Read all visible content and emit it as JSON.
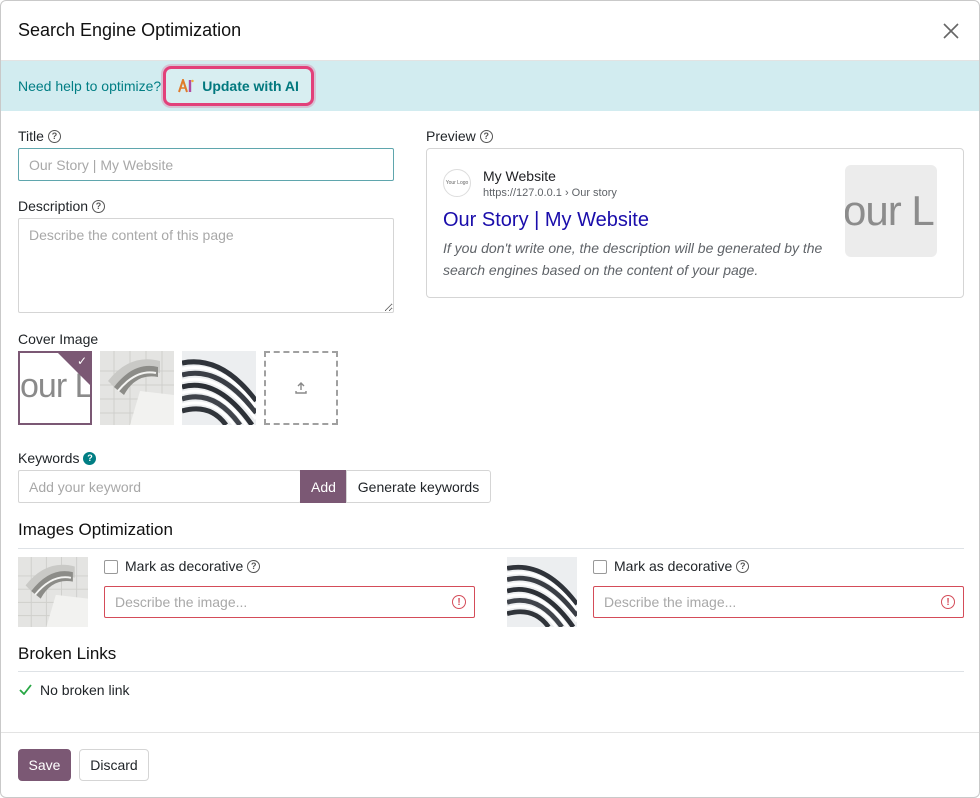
{
  "dialog": {
    "title": "Search Engine Optimization"
  },
  "banner": {
    "text": "Need help to optimize?",
    "ai_button_label": "Update with AI"
  },
  "form": {
    "title_label": "Title",
    "title_placeholder": "Our Story | My Website",
    "description_label": "Description",
    "description_placeholder": "Describe the content of this page",
    "cover_image_label": "Cover Image",
    "keywords_label": "Keywords",
    "keyword_placeholder": "Add your keyword",
    "add_button_label": "Add",
    "generate_keywords_label": "Generate keywords"
  },
  "preview": {
    "label": "Preview",
    "logo_text": "Your Logo",
    "site_name": "My Website",
    "url": "https://127.0.0.1 › Our story",
    "title": "Our Story | My Website",
    "description": "If you don't write one, the description will be generated by the search engines based on the content of your page.",
    "thumbnail_text": "our L"
  },
  "cover_images": {
    "selected_text": "our L"
  },
  "images_optimization": {
    "title": "Images Optimization",
    "items": [
      {
        "mark_label": "Mark as decorative",
        "alt_placeholder": "Describe the image..."
      },
      {
        "mark_label": "Mark as decorative",
        "alt_placeholder": "Describe the image..."
      }
    ]
  },
  "broken_links": {
    "title": "Broken Links",
    "status": "No broken link"
  },
  "footer": {
    "save_label": "Save",
    "discard_label": "Discard"
  },
  "colors": {
    "primary": "#7b5874",
    "banner_bg": "#d2ecf0",
    "ai_border": "#e2407a",
    "link_blue": "#1a0dab",
    "error": "#d44c59",
    "success": "#28a745"
  }
}
